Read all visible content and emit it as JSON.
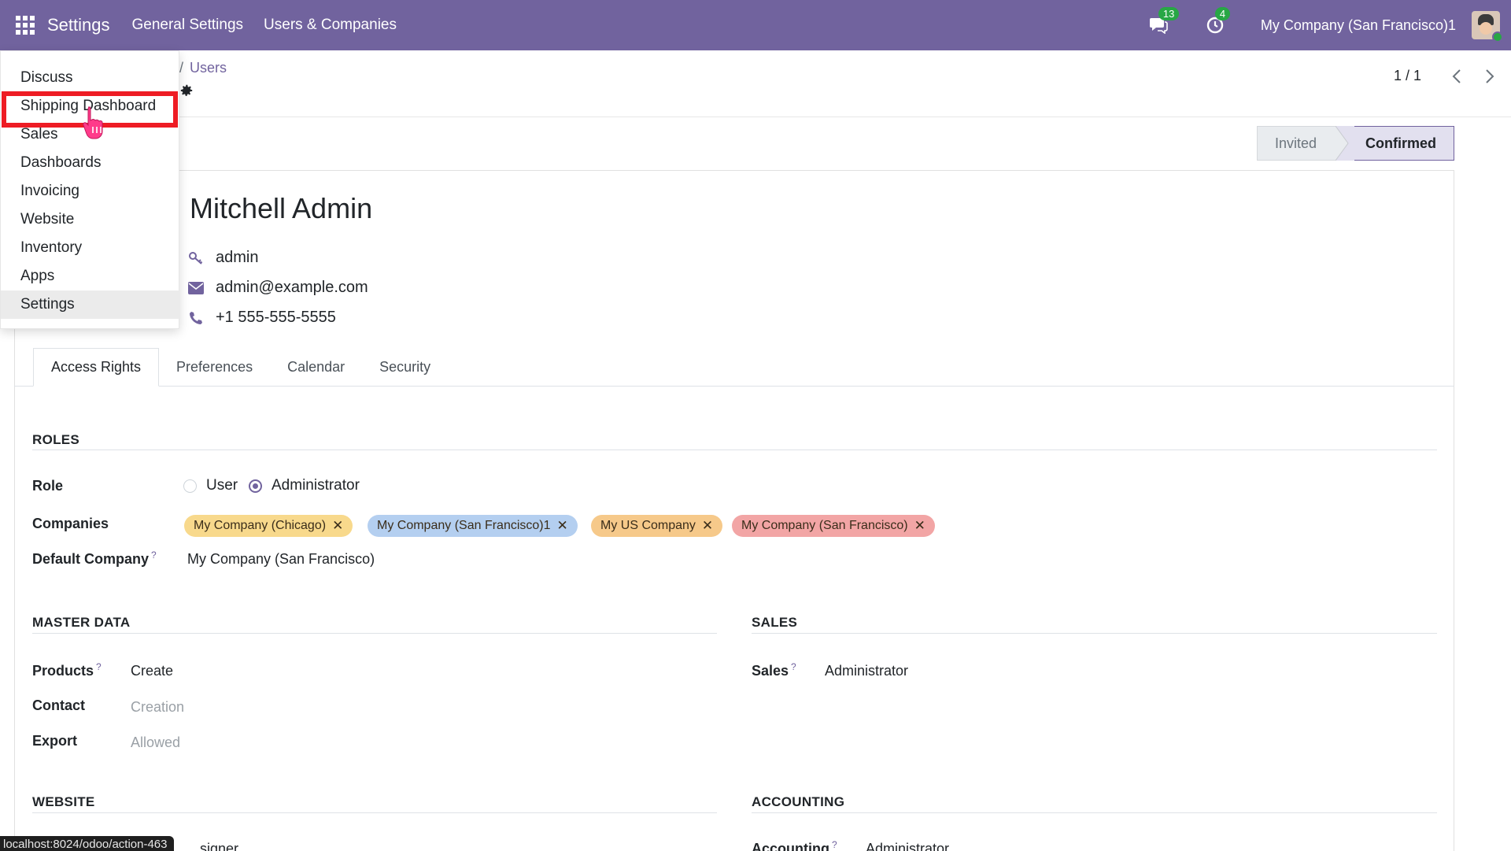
{
  "navbar": {
    "app_title": "Settings",
    "menus": [
      "General Settings",
      "Users & Companies"
    ],
    "messages_count": "13",
    "activities_count": "4",
    "company": "My Company (San Francisco)1"
  },
  "breadcrumb": {
    "current": "Users"
  },
  "pager": {
    "value": "1 / 1"
  },
  "status": {
    "stage1": "Invited",
    "stage2": "Confirmed"
  },
  "user": {
    "name": "Mitchell Admin",
    "login": "admin",
    "email": "admin@example.com",
    "phone": "+1 555-555-5555"
  },
  "tabs": [
    "Access Rights",
    "Preferences",
    "Calendar",
    "Security"
  ],
  "roles": {
    "title": "ROLES",
    "role_label": "Role",
    "role_options": [
      "User",
      "Administrator"
    ],
    "companies_label": "Companies",
    "companies": [
      {
        "name": "My Company (Chicago)",
        "color": "#f8d98c"
      },
      {
        "name": "My Company (San Francisco)1",
        "color": "#b4cff0"
      },
      {
        "name": "My US Company",
        "color": "#f6c98a"
      },
      {
        "name": "My Company (San Francisco)",
        "color": "#f2a5a5"
      }
    ],
    "default_company_label": "Default Company",
    "default_company": "My Company (San Francisco)"
  },
  "master_data": {
    "title": "MASTER DATA",
    "products_label": "Products",
    "products_value": "Create",
    "contact_label": "Contact",
    "contact_value": "Creation",
    "export_label": "Export",
    "export_value": "Allowed"
  },
  "sales": {
    "title": "SALES",
    "label": "Sales",
    "value": "Administrator"
  },
  "website": {
    "title": "WEBSITE",
    "partial_value": "signer"
  },
  "accounting": {
    "title": "ACCOUNTING",
    "label": "Accounting",
    "value": "Administrator"
  },
  "app_menu": {
    "items": [
      "Discuss",
      "Shipping Dashboard",
      "Sales",
      "Dashboards",
      "Invoicing",
      "Website",
      "Inventory",
      "Apps",
      "Settings"
    ]
  },
  "url_tooltip": "localhost:8024/odoo/action-463",
  "colors": {
    "brand": "#71639e",
    "highlight": "#ee1c24"
  }
}
